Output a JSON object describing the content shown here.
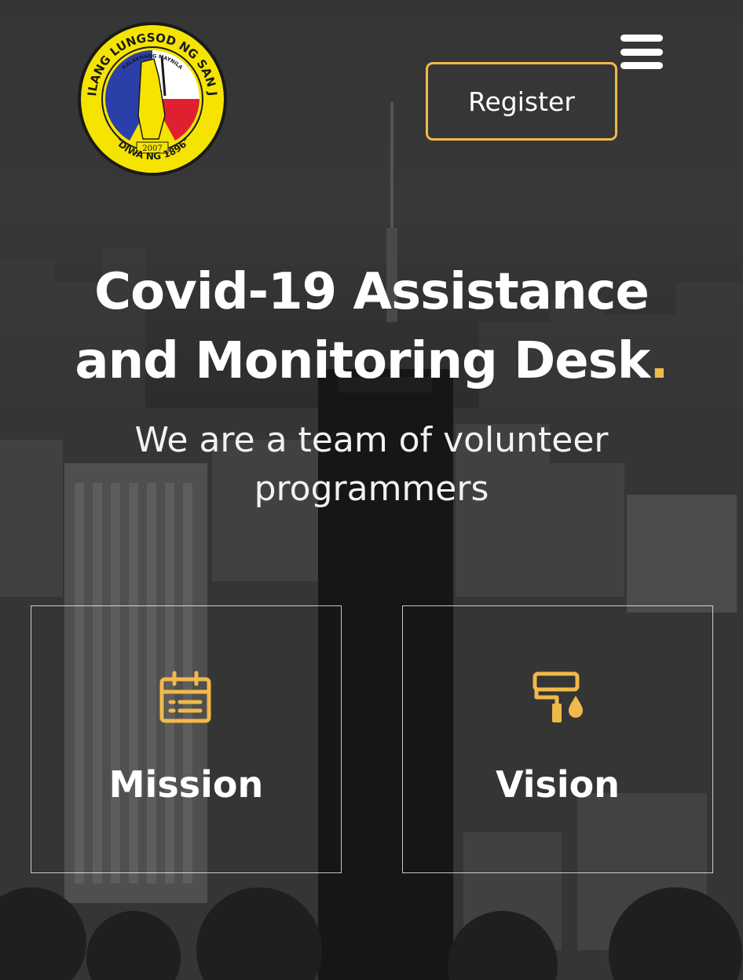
{
  "header": {
    "logo": {
      "icon": "san-juan-city-seal",
      "ring_text": "DAKILANG LUNGSOD NG SAN JUAN",
      "inner_text": "KALAKHANG MAYNILA",
      "year": "2007",
      "motto": "\"DIWA NG 1896\""
    },
    "register_label": "Register",
    "menu_icon": "hamburger-menu-icon"
  },
  "hero": {
    "title_line1": "Covid-19 Assistance",
    "title_line2": "and Monitoring Desk",
    "title_dot": ".",
    "subtitle_line1": "We are a team of volunteer",
    "subtitle_line2": "programmers"
  },
  "cards": [
    {
      "label": "Mission",
      "icon": "calendar-icon"
    },
    {
      "label": "Vision",
      "icon": "paint-roller-icon"
    }
  ],
  "colors": {
    "accent": "#f0b94a",
    "text": "#ffffff",
    "seal_yellow": "#f5e400",
    "seal_blue": "#2a3fa8",
    "seal_red": "#e02030"
  }
}
